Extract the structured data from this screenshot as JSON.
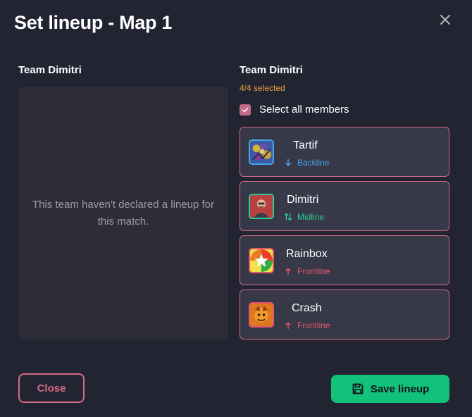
{
  "dialog": {
    "title": "Set lineup - Map 1",
    "close_icon": "close-icon"
  },
  "left_team": {
    "name": "Team Dimitri",
    "empty_message": "This team haven't declared a lineup for this match."
  },
  "right_team": {
    "name": "Team Dimitri",
    "selected_count": "4/4 selected",
    "select_all_label": "Select all members",
    "select_all_checked": true,
    "members": [
      {
        "name": "Tartif",
        "role": "Backline",
        "role_icon": "arrow-down-icon",
        "role_color": "#4aa6e8",
        "avatar_border": "#4aa6e8",
        "selected": true
      },
      {
        "name": "Dimitri",
        "role": "Midline",
        "role_icon": "arrows-updown-icon",
        "role_color": "#2ecc93",
        "avatar_border": "#2ecc93",
        "selected": true
      },
      {
        "name": "Rainbox",
        "role": "Frontline",
        "role_icon": "arrow-up-icon",
        "role_color": "#e5566c",
        "avatar_border": "#e5566c",
        "selected": true
      },
      {
        "name": "Crash",
        "role": "Frontline",
        "role_icon": "arrow-up-icon",
        "role_color": "#e5566c",
        "avatar_border": "#e5566c",
        "selected": true
      }
    ]
  },
  "footer": {
    "close_label": "Close",
    "save_label": "Save lineup",
    "save_icon": "floppy-disk-icon"
  },
  "colors": {
    "accent_pink": "#d36b86",
    "accent_green": "#12c27a",
    "selected_orange": "#e8a23e",
    "background": "#222431"
  }
}
